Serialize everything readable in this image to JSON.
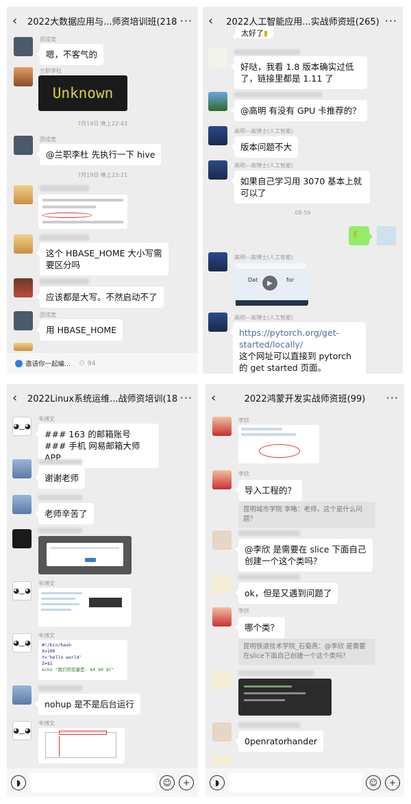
{
  "p1": {
    "title": "2022大数据应用与...师资培训班(218)",
    "names": [
      "邵成宽",
      "兰职李杜",
      "邵成宽",
      "邵成宽"
    ],
    "unknown": "Unknown",
    "time1": "7月19日 晚上22:43",
    "time2": "7月19日 晚上23:21",
    "msgs": [
      "嗯，不客气的",
      "@兰职李杜  先执行一下 hive",
      "这个 HBASE_HOME 大小写需要区分吗",
      "应该都是大写。不然启动不了",
      "用 HBASE_HOME"
    ],
    "invite": "邀请你一起编...",
    "invite_count": "94"
  },
  "p2": {
    "title": "2022人工智能应用...实战师资班(265)",
    "top": "太好了",
    "names": [
      "高明—高博士(人工智能)",
      "高明—高博士(人工智能)",
      "高明—高博士(人工智能)",
      "高明—高博士(人工智能)"
    ],
    "msgs": [
      "好哒，我看 1.8 版本确实过低了，链接里都是 1.11 了",
      "@高明  有没有 GPU 卡推荐的？",
      "版本问题不大",
      "如果自己学习用 3070 基本上就可以了"
    ],
    "time": "08:59",
    "video_text1": "Dat",
    "video_text2": "for",
    "link": "https://pytorch.org/get-started/locally/",
    "link_desc": "这个网址可以直接到 pytorch 的 get started 页面。"
  },
  "p3": {
    "title": "2022Linux系统运维...战师资培训(189)",
    "names": [
      "韦博文",
      "韦博文",
      "韦博文",
      "韦博文"
    ],
    "msg1": "### 163 的邮箱账号\n### 手机  网易邮箱大师 APP",
    "msgs": [
      "谢谢老师",
      "老师辛苦了",
      "nohup  是不是后台运行"
    ],
    "code": [
      "#!/bin/bash",
      "X=100",
      "Y='hello world'",
      "Z=$1",
      "echo \"我们的变量是: $4 $0 $C\""
    ]
  },
  "p4": {
    "title": "2022鸿蒙开发实战师资班(99)",
    "names": [
      "李欣",
      "李欣",
      "李欣"
    ],
    "msgs": [
      "导入工程的？",
      "@李欣  是需要在 slice 下面自己创建一个这个类吗？",
      "ok，但是又遇到问题了",
      "哪个类？",
      "0penratorhander"
    ],
    "quote1": "昆明城市学院 李略：老师，这个是什么问题？",
    "quote2": "昆明铁道技术学院_石菊燕：@李欣 是需要在slice下面自己创建一个这个类吗？"
  },
  "icons": [
    "back-icon",
    "more-icon",
    "voice-icon",
    "emoji-icon",
    "plus-icon",
    "play-icon"
  ]
}
